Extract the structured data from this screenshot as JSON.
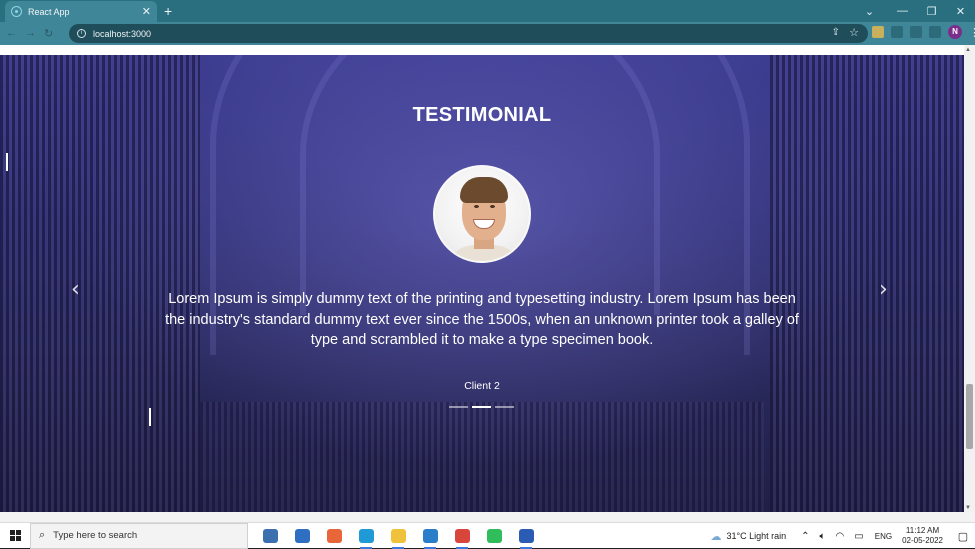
{
  "browser": {
    "tab_title": "React App",
    "tab_close": "✕",
    "new_tab": "+",
    "url": "localhost:3000",
    "window_controls": {
      "tab_list": "⌄",
      "minimize": "—",
      "restore": "❐",
      "close": "✕"
    },
    "profile_initial": "N"
  },
  "testimonial": {
    "heading": "TESTIMONIAL",
    "quote": "Lorem Ipsum is simply dummy text of the printing and typesetting industry. Lorem Ipsum has been the industry's standard dummy text ever since the 1500s, when an unknown printer took a galley of type and scrambled it to make a type specimen book.",
    "client": "Client 2",
    "prev_glyph": "‹",
    "next_glyph": "›",
    "active_slide": 2,
    "slide_count": 3
  },
  "taskbar": {
    "search_placeholder": "Type here to search",
    "apps": [
      {
        "name": "task-view",
        "color": "#3a6fb0",
        "active": false
      },
      {
        "name": "mail",
        "color": "#2f6fc2",
        "active": false
      },
      {
        "name": "firefox",
        "color": "#e8663a",
        "active": false
      },
      {
        "name": "edge",
        "color": "#1f9ad6",
        "active": true
      },
      {
        "name": "file-explorer",
        "color": "#f0c23b",
        "active": true
      },
      {
        "name": "vscode",
        "color": "#2a7ec9",
        "active": true
      },
      {
        "name": "chrome",
        "color": "#d8453b",
        "active": true
      },
      {
        "name": "whatsapp",
        "color": "#2fbe5b",
        "active": false
      },
      {
        "name": "word",
        "color": "#2b5bb3",
        "active": true
      }
    ],
    "weather": "31°C  Light rain",
    "language": "ENG",
    "time": "11:12 AM",
    "date": "02-05-2022"
  }
}
